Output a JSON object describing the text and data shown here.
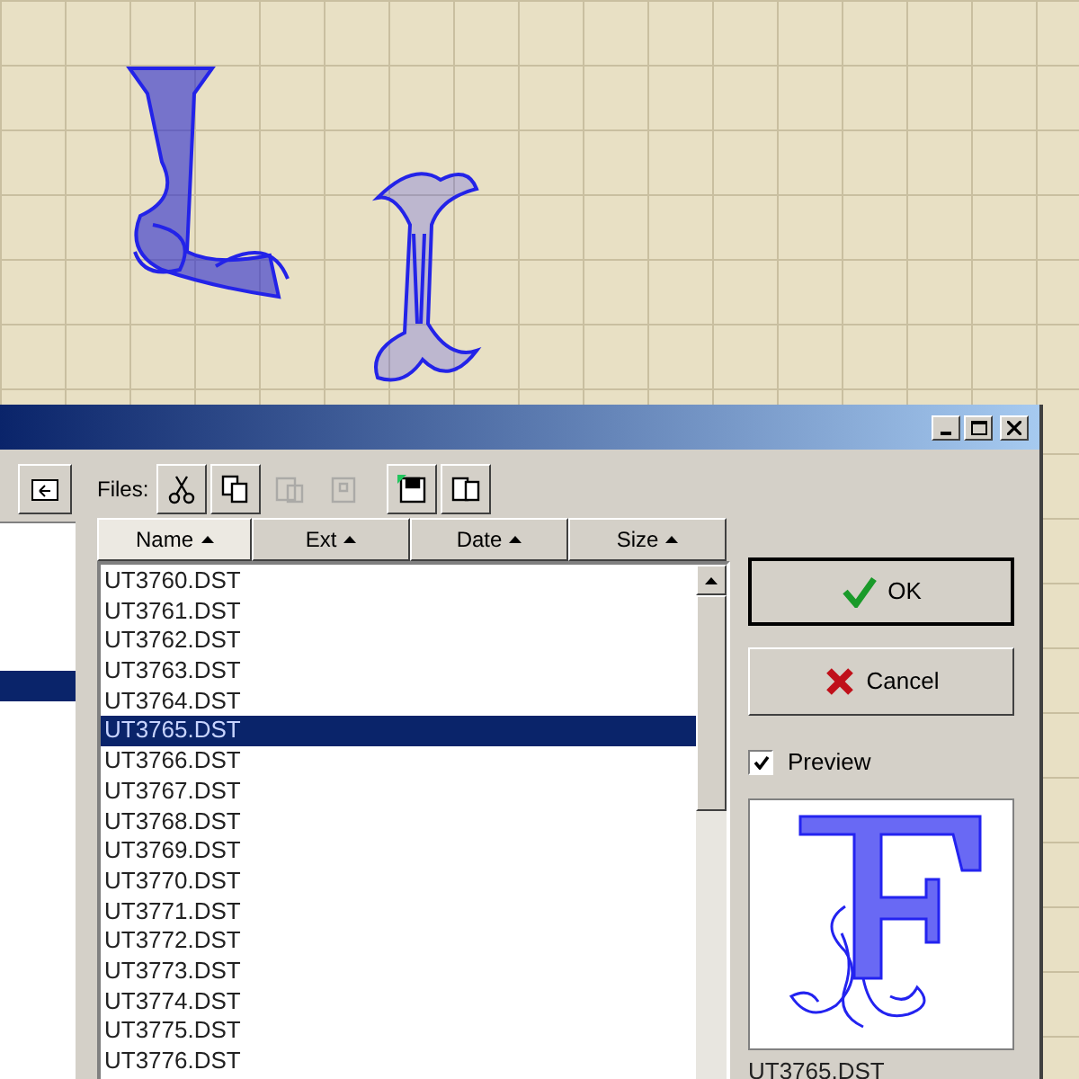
{
  "dialog": {
    "toolbar": {
      "label": "Files:",
      "buttons": [
        {
          "kind": "cut",
          "disabled": false
        },
        {
          "kind": "copy",
          "disabled": false
        },
        {
          "kind": "paste",
          "disabled": true
        },
        {
          "kind": "paste-special",
          "disabled": true
        },
        {
          "kind": "save",
          "disabled": false
        },
        {
          "kind": "duplicate",
          "disabled": false
        }
      ]
    },
    "columns": [
      {
        "label": "Name",
        "selected": true
      },
      {
        "label": "Ext",
        "selected": false
      },
      {
        "label": "Date",
        "selected": false
      },
      {
        "label": "Size",
        "selected": false
      }
    ],
    "files": [
      {
        "name": "UT3760.DST",
        "selected": false
      },
      {
        "name": "UT3761.DST",
        "selected": false
      },
      {
        "name": "UT3762.DST",
        "selected": false
      },
      {
        "name": "UT3763.DST",
        "selected": false
      },
      {
        "name": "UT3764.DST",
        "selected": false
      },
      {
        "name": "UT3765.DST",
        "selected": true
      },
      {
        "name": "UT3766.DST",
        "selected": false
      },
      {
        "name": "UT3767.DST",
        "selected": false
      },
      {
        "name": "UT3768.DST",
        "selected": false
      },
      {
        "name": "UT3769.DST",
        "selected": false
      },
      {
        "name": "UT3770.DST",
        "selected": false
      },
      {
        "name": "UT3771.DST",
        "selected": false
      },
      {
        "name": "UT3772.DST",
        "selected": false
      },
      {
        "name": "UT3773.DST",
        "selected": false
      },
      {
        "name": "UT3774.DST",
        "selected": false
      },
      {
        "name": "UT3775.DST",
        "selected": false
      },
      {
        "name": "UT3776.DST",
        "selected": false
      }
    ],
    "buttons": [
      {
        "kind": "ok",
        "label": "OK"
      },
      {
        "kind": "cancel",
        "label": "Cancel"
      }
    ],
    "preview": {
      "label": "Preview",
      "checked": true,
      "filename": "UT3765.DST"
    }
  }
}
